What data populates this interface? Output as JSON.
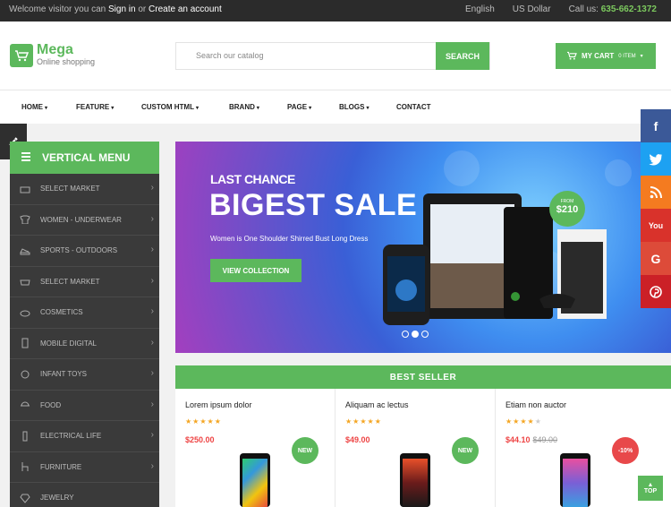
{
  "topbar": {
    "welcome_prefix": "Welcome visitor you can",
    "sign_in": "Sign in",
    "or": "or",
    "create_account": "Create an account",
    "language": "English",
    "currency": "US Dollar",
    "call_label": "Call us:",
    "phone": "635-662-1372"
  },
  "header": {
    "brand": "Mega",
    "tagline": "Online shopping",
    "search_placeholder": "Search our catalog",
    "search_button": "SEARCH",
    "cart_label": "MY CART",
    "cart_count": "0 ITEM"
  },
  "nav": {
    "items": [
      "HOME",
      "FEATURE",
      "CUSTOM HTML",
      "BRAND",
      "PAGE",
      "BLOGS",
      "CONTACT"
    ]
  },
  "vertical_menu": {
    "title": "VERTICAL MENU",
    "items": [
      "SELECT MARKET",
      "WOMEN - UNDERWEAR",
      "SPORTS - OUTDOORS",
      "SELECT MARKET",
      "COSMETICS",
      "MOBILE DIGITAL",
      "INFANT TOYS",
      "FOOD",
      "ELECTRICAL LIFE",
      "FURNITURE",
      "JEWELRY"
    ]
  },
  "hero": {
    "kicker": "LAST CHANCE",
    "headline": "BIGEST SALE",
    "subline": "Women is One Shoulder Shirred Bust Long Dress",
    "cta": "VIEW COLLECTION",
    "badge_from": "FROM",
    "badge_price": "$210",
    "slide_count": 3,
    "active_slide": 2
  },
  "best_seller": {
    "title": "BEST SELLER",
    "products": [
      {
        "name": "Lorem ipsum dolor",
        "rating": 5,
        "price": "$250.00",
        "old_price": "",
        "badge": "NEW",
        "badge_color": "#5cb85c"
      },
      {
        "name": "Aliquam ac lectus",
        "rating": 5,
        "price": "$49.00",
        "old_price": "",
        "badge": "NEW",
        "badge_color": "#5cb85c"
      },
      {
        "name": "Etiam non auctor",
        "rating": 4,
        "price": "$44.10",
        "old_price": "$49.00",
        "badge": "-10%",
        "badge_color": "#e8484a"
      }
    ]
  },
  "social": {
    "facebook": "f",
    "twitter": "t",
    "rss": "rss",
    "youtube": "You",
    "google": "G",
    "pinterest": "P"
  },
  "to_top": "TOP",
  "colors": {
    "accent": "#5cb85c",
    "topbar": "#2b2b2b",
    "menu_bg": "#3a3a3a",
    "price": "#e44444"
  }
}
